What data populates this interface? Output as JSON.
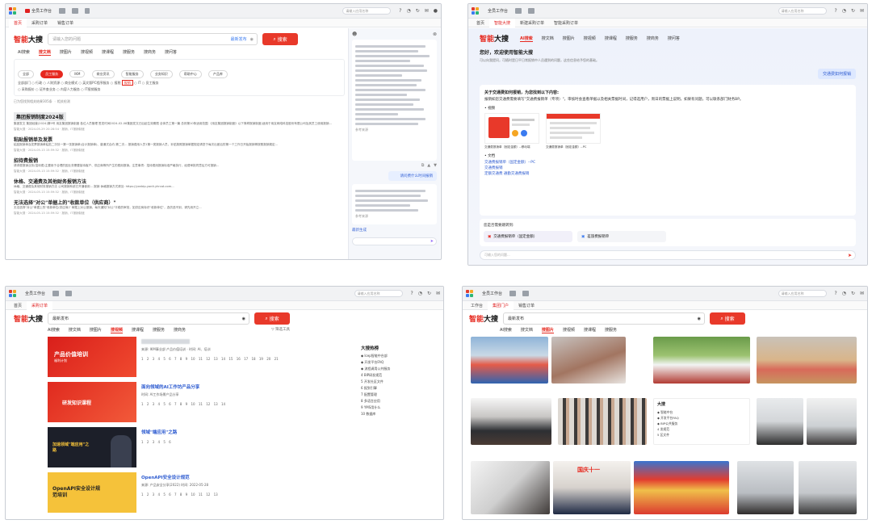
{
  "common": {
    "browser_tabs": [
      "首页",
      "采购订单",
      "销售订单"
    ],
    "workspace_tab": "全员工作台",
    "search_placeholder": "请输入应用名称",
    "brand_red": "智能",
    "brand_black": "大搜",
    "accent": "#e6281e"
  },
  "panel1": {
    "tab_active": "首页",
    "search_placeholder": "请输入您的问题",
    "latest": "最新发布",
    "search_button": "搜索",
    "nav_tabs": [
      "AI搜索",
      "搜文档",
      "搜图片",
      "搜视频",
      "搜课程",
      "搜服务",
      "搜商务",
      "搜问答"
    ],
    "filter_row1": [
      "全部",
      "员工服务",
      "IKM",
      "商业资讯",
      "智能服务",
      "业务知识",
      "帮助中心",
      "产品库"
    ],
    "filter_row2": [
      "全部部门",
      "行政",
      "人财资源",
      "商业模式",
      "英文版PC程序服务",
      "报税",
      "报销",
      "IT",
      "员工服务"
    ],
    "filter_row3": [
      "采购报价",
      "证件查业务",
      "内容人力服务",
      "IT报销服务"
    ],
    "result_count": "已为您找到相关结果305条",
    "related": "相关检测",
    "results": [
      {
        "title": "集团报销制度2024版",
        "text": "集团发文 集团经营(2024)第9号 用友集团报销制度 各位人员管理 签发时间2024-02-08集团发文已后起生效期限 全体员工第一篇 总则第10条适用范围 《用友集团报销制度》以下简称报销制度)适用于用友网络科技股份有限公司及其员工使用报销...",
        "author": "智能大搜",
        "date": "2024-05-29 20:28:54",
        "tag": "报销、IT报销制度"
      },
      {
        "title": "粘贴报销单及发票",
        "text": "粘贴报销单及发票报销单粘贴二次处一第一张报销单(合计报销单)、普通式合约-第二次... 报销费用人员1第一类报销人员，补贴按照报销单据规定请您于每次出差后的第一个工作日开始报销等按照报销规定...",
        "author": "智能大搜",
        "date": "2024-05-13 15:59:32",
        "tag": "报销、IT报销制度"
      },
      {
        "title": "招待费报销",
        "text": "请求费报销业务(招待费)主要用于合理的因业务需要接待客户、供应商等所产生的费用报销。注意事项：招待费用报销标准严格执行，经费审批同意后方可报销...",
        "author": "智能大搜",
        "date": "2024-05-13 15:59:32",
        "tag": "报销、IT报销制度"
      },
      {
        "title": "休格、交通费及其他财务报销方法",
        "text": "休格、交通费及其他财务报销方法 公司报销系统已开通使用... 报销 休格报销方式请见: https://yonbip-yonit.yhrcat.com...",
        "author": "智能大搜",
        "date": "2024-05-13 15:59:32",
        "tag": "报销、IT报销制度"
      },
      {
        "title": "无法选择\"对公\"单据上的\"收款单位（供应商）\"",
        "text": "无法选择\"对公\"单据上的\"收款单位(供应商)\" 单据上对公报销，每天通知\"对公\"平稳的审批，如供应商标识\"收款单位\"，选供选不到，请先用开立...",
        "author": "智能大搜",
        "date": "2024-05-13 15:59:32",
        "tag": "报销、IT报销制度"
      }
    ],
    "chat_suggestion": "请问费什么时间报销",
    "chat_label": "最新生成",
    "chat_footer": "参考来源"
  },
  "panel2": {
    "tabs": [
      "首页",
      "智能大搜",
      "新建采购订单",
      "智能采购订单"
    ],
    "nav_tabs": [
      "AI搜索",
      "搜文档",
      "搜图片",
      "搜视频",
      "搜课程",
      "搜服务",
      "搜商务",
      "搜问答"
    ],
    "welcome": "您好，欢迎使用智能大搜",
    "welcome_sub": "可以向我提问，可随时是日平日常报销中人员遇到的问题，这些信息给予您的基础。",
    "user_question": "交通费如何报销",
    "answer_head": "关于交通费如何报销，为您找到以下内容:",
    "answer_text": "报销如您交通费需要填写\"交通费报销单（专项）\"，审核时会查看单据以及相关票据时间，记得选用户，周日的票据上说明，如果有问题，可以联系部门财务BP。",
    "video_label": "视频",
    "cards": [
      {
        "caption": "交通费报销单（固定金额）--移动端"
      },
      {
        "caption": "交通费报销单（固定金额）--PC"
      }
    ],
    "doc_label": "文档",
    "links": [
      "交通费报销单（固定金额）--PC",
      "交通费报销",
      "定额交通费 通勤交通费报销"
    ],
    "jump_label": "您是否需要跳转到:",
    "jump_options": [
      "交通费报销单（固定金额）",
      "差旅费报销单"
    ],
    "input_placeholder": "可输入您的问题..."
  },
  "panel3": {
    "search_text": "最新发布",
    "search_button": "搜索",
    "nav_tabs": [
      "AI搜索",
      "搜文档",
      "搜图片",
      "搜视频",
      "搜课程",
      "搜服务",
      "搜商务"
    ],
    "filter": "筛选工具",
    "results": [
      {
        "thumb_top": "产品价值培训",
        "thumb_sub": "福利计划",
        "meta": "来源: IKM事业部 产品价值培训 · 时间: AI、培训",
        "title": "",
        "pages": [
          "1",
          "2",
          "3",
          "4",
          "5",
          "6",
          "7",
          "8",
          "9",
          "10",
          "11",
          "12",
          "13",
          "14",
          "15",
          "16",
          "17",
          "18",
          "19",
          "20",
          "21"
        ]
      },
      {
        "thumb_top": "研发知识课程",
        "thumb_sub": "",
        "meta": "时间: AI工作场景产品分享",
        "title": "面向领域的AI工作坊产品分享",
        "pages": [
          "1",
          "2",
          "3",
          "4",
          "5",
          "6",
          "7",
          "8",
          "9",
          "10",
          "11",
          "12",
          "13",
          "14"
        ]
      },
      {
        "thumb_top": "加速领域\"端应用\"之路",
        "thumb_sub": "",
        "meta": "",
        "title": "领域\"端应用\"之路",
        "pages": [
          "1",
          "2",
          "3",
          "4",
          "5",
          "6"
        ]
      },
      {
        "thumb_top": "OpenAPI安全设计规范培训",
        "thumb_sub": "",
        "meta": "来源: 产品安全分享(2022) 时间: 2022-05-28",
        "title": "OpenAPI安全设计规范",
        "pages": [
          "1",
          "2",
          "3",
          "4",
          "5",
          "6",
          "7",
          "8",
          "9",
          "10",
          "11",
          "12",
          "13"
        ]
      }
    ],
    "hot_title": "大搜热榜",
    "hot_items": [
      "Icep智能中台部",
      "开发平台FAQ",
      "流程调用公共服务",
      "BIP研发规范",
      "开发社区文件",
      "报到引擎",
      "配置管理",
      "多语言应用",
      "YMS用什么",
      "数据库"
    ]
  },
  "panel4": {
    "tabs": [
      "工作台",
      "集团门户",
      "销售订单"
    ],
    "search_text": "最新发布",
    "search_button": "搜索",
    "nav_tabs": [
      "AI搜索",
      "搜文档",
      "搜图片",
      "搜视频",
      "搜课程",
      "搜服务"
    ],
    "hot_title": "大搜",
    "hot_items": [
      "智能中台",
      "开发平台FAQ",
      "BIP公共服务",
      "发规范",
      "区文件"
    ],
    "banner_text": "国庆十一"
  }
}
